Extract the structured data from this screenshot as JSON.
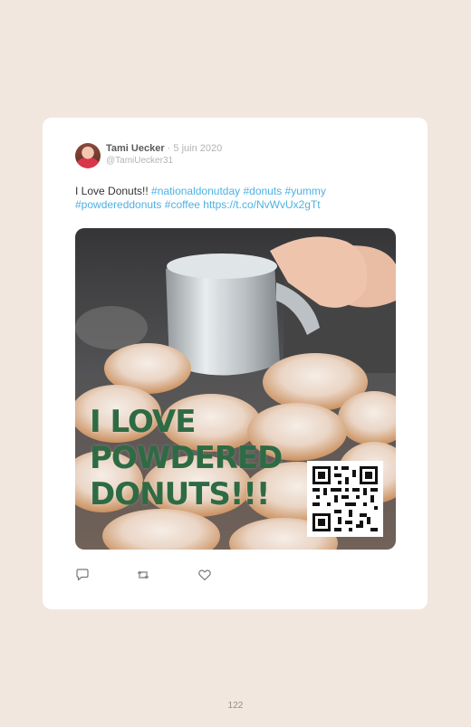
{
  "tweet": {
    "author_name": "Tami Uecker",
    "separator": "·",
    "date": "5 juin 2020",
    "handle": "@TamiUecker31",
    "text_plain": "I Love Donuts!! ",
    "hashtags": [
      "#nationaldonutday",
      "#donuts",
      "#yummy",
      "#powdereddonuts",
      "#coffee"
    ],
    "link": "https://t.co/NvWvUx2gTt"
  },
  "media": {
    "poster_lines": [
      "I LOVE",
      "POWDERED",
      "DONUTS!!!"
    ],
    "poster_color": "#2e6b44",
    "qr_code": "qr-code"
  },
  "actions": [
    {
      "icon": "reply-icon"
    },
    {
      "icon": "retweet-icon"
    },
    {
      "icon": "like-icon"
    }
  ],
  "footer": {
    "page_number": "122"
  },
  "colors": {
    "background": "#f2e7de",
    "card": "#ffffff",
    "link": "#4db1e3",
    "muted": "#b3b3b3"
  }
}
